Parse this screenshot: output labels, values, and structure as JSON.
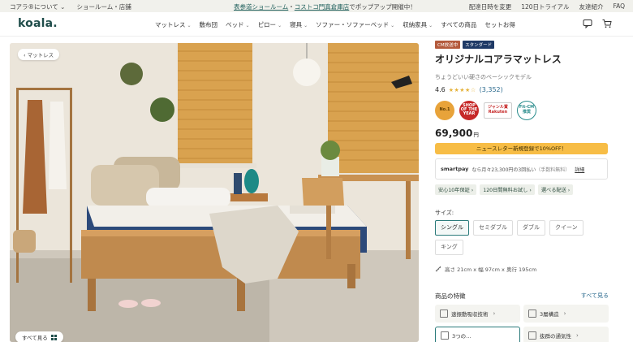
{
  "topbar": {
    "left_items": [
      "コアラ®について",
      "ショールーム・店舗"
    ],
    "announcement_link1": "表参道ショールーム",
    "announcement_sep": "・",
    "announcement_link2": "コストコ門真倉庫店",
    "announcement_rest": "でポップアップ開催中！",
    "right_items": [
      "配達日時を変更",
      "120日トライアル",
      "友達紹介",
      "FAQ"
    ]
  },
  "header": {
    "logo": "koala.",
    "nav": [
      {
        "label": "マットレス",
        "chevron": true
      },
      {
        "label": "敷布団",
        "chevron": false
      },
      {
        "label": "ベッド",
        "chevron": true
      },
      {
        "label": "ピロー",
        "chevron": true
      },
      {
        "label": "寝具",
        "chevron": true
      },
      {
        "label": "ソファー・ソファーベッド",
        "chevron": true
      },
      {
        "label": "収納家具",
        "chevron": true
      },
      {
        "label": "すべての商品",
        "chevron": false
      },
      {
        "label": "セットお得",
        "chevron": false
      }
    ]
  },
  "hero": {
    "breadcrumb": "‹ マットレス",
    "see_all": "すべて見る"
  },
  "product": {
    "badges": [
      "CM放送中",
      "スタンダード"
    ],
    "title": "オリジナルコアラマットレス",
    "subtitle": "ちょうどいい硬さのベーシックモデル",
    "rating": "4.6",
    "rating_value": 4.6,
    "review_count": "(3,352)",
    "awards": [
      "No.1",
      "SHOP OF THE YEAR",
      "ジャンル賞 Rakuten",
      "Fit-CM 推奨"
    ],
    "price": "69,900",
    "price_unit": "円",
    "promo": "ニュースレター新規登録で10%OFF！",
    "smartpay": {
      "brand": "smartpay",
      "text": "なら月々23,300円の3回払い",
      "sub": "（手数料無料）",
      "link": "詳細"
    },
    "perks": [
      "安心10年保証 ›",
      "120日間無料お試し ›",
      "選べる配送 ›"
    ],
    "size_label": "サイズ:",
    "sizes": [
      "シングル",
      "セミダブル",
      "ダブル",
      "クイーン",
      "キング"
    ],
    "selected_size": "シングル",
    "dimensions": "高さ 21cm x 幅 97cm x 奥行 195cm",
    "features_title": "商品の特徴",
    "features_all": "すべて見る",
    "features": [
      "速振動吸収技術",
      "3層構造",
      "3つの…",
      "抜群の通気性"
    ]
  },
  "colors": {
    "accent": "#1f4d4a",
    "promo": "#f7bd46",
    "star": "#e5b23a",
    "link": "#2c6b8f"
  }
}
